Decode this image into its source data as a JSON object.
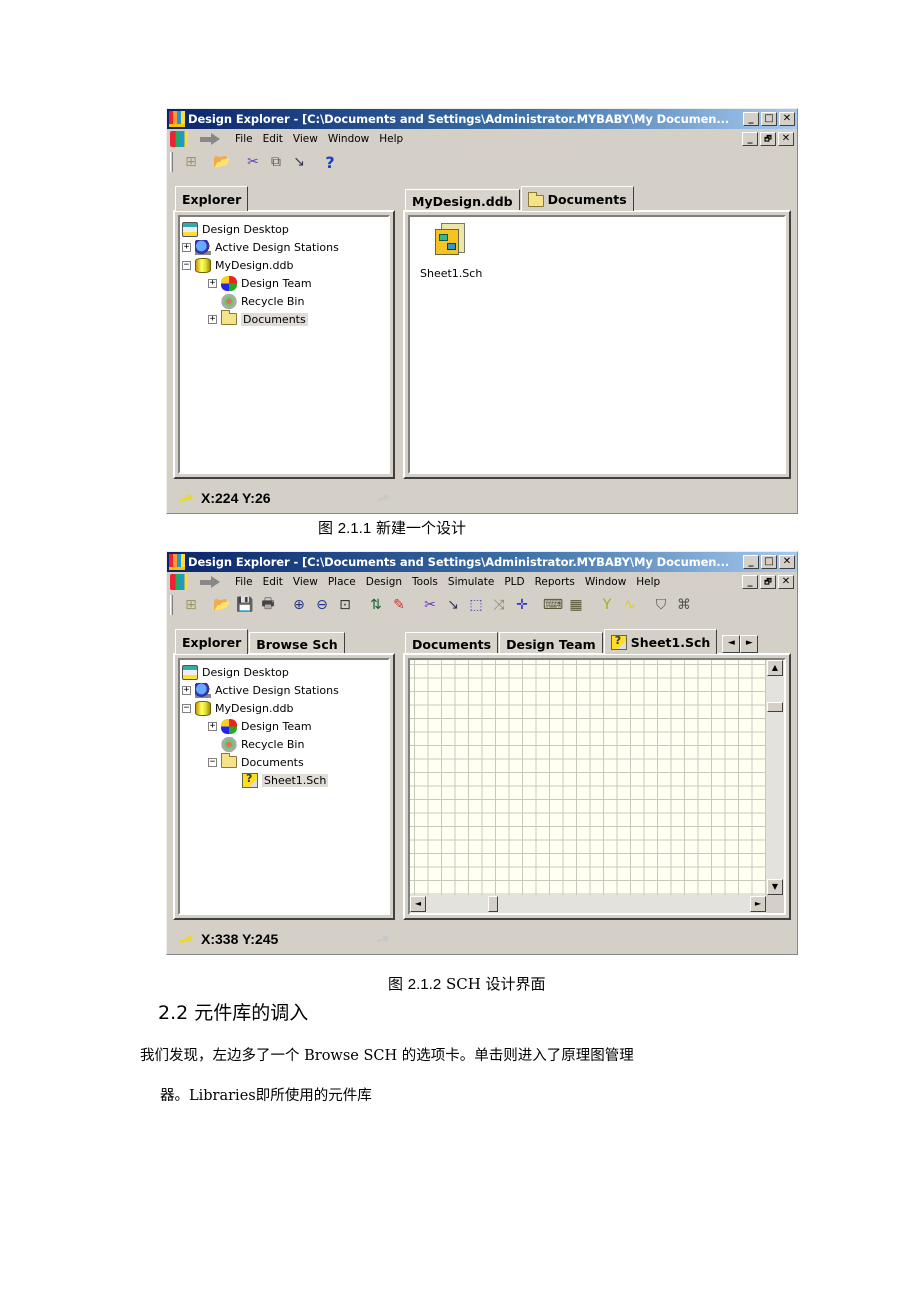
{
  "figure1": {
    "window_title": "Design Explorer - [C:\\Documents and Settings\\Administrator.MYBABY\\My Documen...",
    "menu": [
      "File",
      "Edit",
      "View",
      "Window",
      "Help"
    ],
    "menu_mnemonics": [
      "F",
      "E",
      "V",
      "W",
      "H"
    ],
    "toolbar_icons": [
      "design-manager-icon",
      "open-folder-icon",
      "cut-icon",
      "copy-icon",
      "paste-icon",
      "help-icon"
    ],
    "left_tabs": [
      "Explorer"
    ],
    "tree": [
      {
        "label": "Design Desktop",
        "icon": "desktop-icon",
        "level": 0,
        "expander": ""
      },
      {
        "label": "Active Design Stations",
        "icon": "stations-icon",
        "level": 0,
        "expander": "+"
      },
      {
        "label": "MyDesign.ddb",
        "icon": "database-icon",
        "level": 0,
        "expander": "-"
      },
      {
        "label": "Design Team",
        "icon": "team-icon",
        "level": 1,
        "expander": "+"
      },
      {
        "label": "Recycle Bin",
        "icon": "recycle-bin-icon",
        "level": 1,
        "expander": ""
      },
      {
        "label": "Documents",
        "icon": "folder-icon",
        "level": 1,
        "expander": "+",
        "selected": true
      }
    ],
    "right_tabs": [
      "MyDesign.ddb",
      "Documents"
    ],
    "active_right_tab": "Documents",
    "files": [
      {
        "name": "Sheet1.Sch",
        "icon": "schematic-file-icon"
      }
    ],
    "status": "X:224 Y:26",
    "caption_prefix": "图",
    "caption_num": "2.1.1",
    "caption_text": "新建一个设计"
  },
  "figure2": {
    "window_title": "Design Explorer - [C:\\Documents and Settings\\Administrator.MYBABY\\My Documen...",
    "menu": [
      "File",
      "Edit",
      "View",
      "Place",
      "Design",
      "Tools",
      "Simulate",
      "PLD",
      "Reports",
      "Window",
      "Help"
    ],
    "toolbar_icons": [
      "design-manager-icon",
      "open-folder-icon",
      "save-icon",
      "print-icon",
      "zoom-in-icon",
      "zoom-out-icon",
      "zoom-fit-icon",
      "hierarchy-icon",
      "cross-probe-icon",
      "cut-icon",
      "paste-icon",
      "select-icon",
      "deselect-icon",
      "move-icon",
      "library-icon",
      "browse-library-icon",
      "wiring-tools-icon",
      "drawing-tools-icon",
      "power-icon",
      "digital-objects-icon"
    ],
    "left_tabs": [
      "Explorer",
      "Browse Sch"
    ],
    "tree": [
      {
        "label": "Design Desktop",
        "icon": "desktop-icon",
        "level": 0,
        "expander": ""
      },
      {
        "label": "Active Design Stations",
        "icon": "stations-icon",
        "level": 0,
        "expander": "+"
      },
      {
        "label": "MyDesign.ddb",
        "icon": "database-icon",
        "level": 0,
        "expander": "-"
      },
      {
        "label": "Design Team",
        "icon": "team-icon",
        "level": 1,
        "expander": "+"
      },
      {
        "label": "Recycle Bin",
        "icon": "recycle-bin-icon",
        "level": 1,
        "expander": ""
      },
      {
        "label": "Documents",
        "icon": "folder-icon",
        "level": 1,
        "expander": "-"
      },
      {
        "label": "Sheet1.Sch",
        "icon": "schematic-file-icon",
        "level": 2,
        "expander": "",
        "selected": true
      }
    ],
    "right_tabs": [
      "Documents",
      "Design Team",
      "Sheet1.Sch"
    ],
    "active_right_tab": "Sheet1.Sch",
    "status": "X:338 Y:245",
    "caption_prefix": "图",
    "caption_num": "2.1.2",
    "caption_text": "SCH 设计界面"
  },
  "section": {
    "heading": "2.2 元件库的调入",
    "para_line1": "我们发现，左边多了一个 Browse SCH 的选项卡。单击则进入了原理图管理",
    "para_line2": "器。Libraries即所使用的元件库"
  },
  "window_buttons": {
    "minimize": "_",
    "maximize": "□",
    "restore": "🗗",
    "close": "✕"
  },
  "scroll_glyphs": {
    "up": "▲",
    "down": "▼",
    "left": "◄",
    "right": "►"
  }
}
